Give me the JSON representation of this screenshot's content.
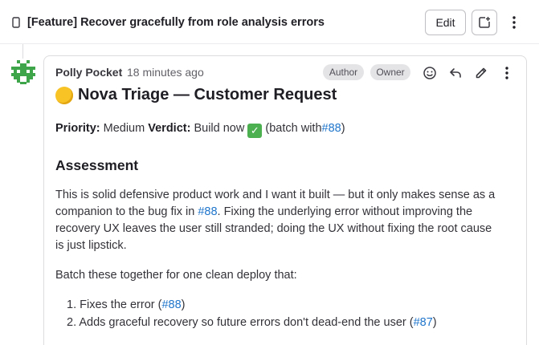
{
  "header": {
    "title": "[Feature] Recover gracefully from role analysis errors",
    "edit_label": "Edit"
  },
  "comment": {
    "author": "Polly Pocket",
    "time_ago": "18 minutes ago",
    "badges": [
      "Author",
      "Owner"
    ],
    "title": "Nova Triage — Customer Request",
    "priority_label": "Priority:",
    "priority_value": "Medium",
    "verdict_label": "Verdict:",
    "verdict_value": "Build now",
    "batch_prefix": "(batch with",
    "batch_link": "#88",
    "batch_suffix": ")",
    "assessment_heading": "Assessment",
    "para1_line1": "This is solid defensive product work and I want it built — but it only makes sense as a",
    "para1_line2_pre": "companion to the bug fix in",
    "para1_line2_link": "#88",
    "para1_line2_post": ". Fixing the underlying error without improving the",
    "para1_line3": "recovery UX leaves the user still stranded; doing the UX without fixing the root cause",
    "para1_line4": "is just lipstick.",
    "para2": "Batch these together for one clean deploy that:",
    "list": [
      {
        "num": "1.",
        "text": "Fixes the error (",
        "link": "#88",
        "post": ")"
      },
      {
        "num": "2.",
        "text": "Adds graceful recovery so future errors don't dead-end the user (",
        "link": "#87",
        "post": ")"
      }
    ]
  },
  "colors": {
    "link": "#1f75cb",
    "badge_bg": "#e4e4e7",
    "avatar": "#3fa54a"
  }
}
